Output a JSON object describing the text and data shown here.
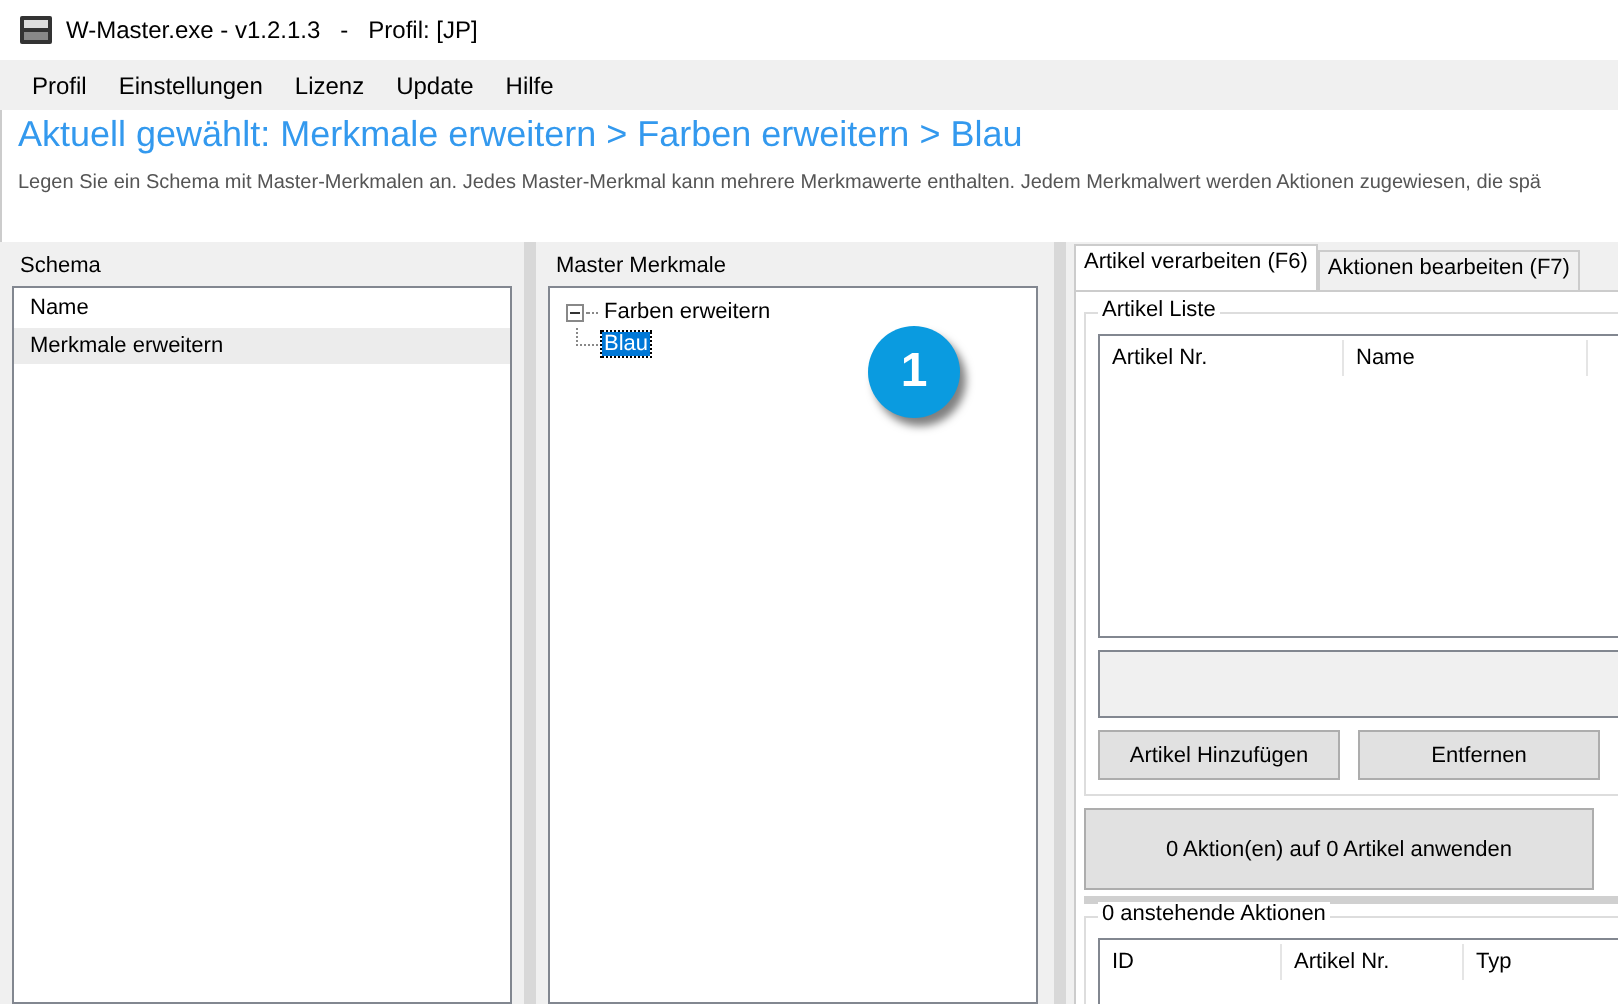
{
  "window": {
    "title": "W-Master.exe - v1.2.1.3   -   Profil: [JP]"
  },
  "menu": [
    "Profil",
    "Einstellungen",
    "Lizenz",
    "Update",
    "Hilfe"
  ],
  "heading": "Aktuell gewählt: Merkmale erweitern > Farben erweitern > Blau",
  "description": "Legen Sie ein Schema mit Master-Merkmalen an. Jedes Master-Merkmal kann mehrere Merkmawerte enthalten. Jedem Merkmalwert werden Aktionen zugewiesen, die spä",
  "schema": {
    "title": "Schema",
    "column": "Name",
    "rows": [
      {
        "name": "Merkmale erweitern",
        "selected": true
      }
    ]
  },
  "master": {
    "title": "Master Merkmale",
    "tree": [
      {
        "label": "Farben erweitern",
        "expanded": true,
        "selected": false,
        "children": [
          {
            "label": "Blau",
            "selected": true
          }
        ]
      }
    ]
  },
  "callout": "1",
  "tabs": [
    {
      "label": "Artikel verarbeiten (F6)",
      "selected": true
    },
    {
      "label": "Aktionen bearbeiten (F7)",
      "selected": false
    }
  ],
  "article_list": {
    "title": "Artikel Liste",
    "columns": [
      "Artikel Nr.",
      "Name"
    ],
    "buttons": [
      "Artikel Hinzufügen",
      "Entfernen"
    ]
  },
  "apply_button": "0  Aktion(en) auf 0 Artikel anwenden",
  "pending": {
    "title": "0 anstehende Aktionen",
    "columns": [
      "ID",
      "Artikel Nr.",
      "Typ"
    ]
  }
}
